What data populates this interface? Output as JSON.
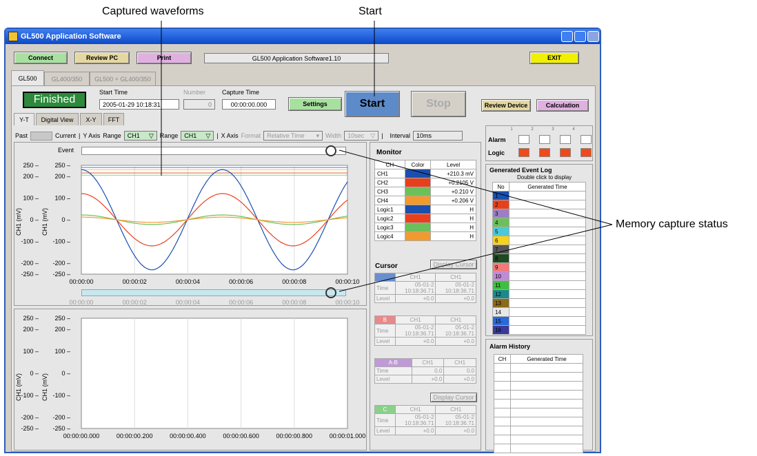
{
  "callouts": {
    "captured_waveforms": "Captured waveforms",
    "start": "Start",
    "memory_capture_status": "Memory capture status"
  },
  "window": {
    "title": "GL500 Application Software"
  },
  "toolbar": {
    "connect": "Connect",
    "review_pc": "Review PC",
    "print": "Print",
    "version": "GL500 Application Software1.10",
    "exit": "EXIT"
  },
  "device_tabs": [
    "GL500",
    "GL400/350",
    "GL500 + GL400/350"
  ],
  "status": {
    "state": "Finished",
    "start_time_label": "Start Time",
    "start_time": "2005-01-29 10:18:31",
    "number_label": "Number",
    "number": "0",
    "capture_time_label": "Capture Time",
    "capture_time": "00:00:00.000",
    "settings": "Settings",
    "start": "Start",
    "stop": "Stop",
    "review_device": "Review Device",
    "calculation": "Calculation"
  },
  "view_tabs": [
    "Y-T",
    "Digital View",
    "X-Y",
    "FFT"
  ],
  "axis_bar": {
    "past": "Past",
    "current": "Current",
    "y_axis": "Y Axis",
    "range_label": "Range",
    "ch": "CH1",
    "x_axis": "X Axis",
    "format_label": "Format",
    "format": "Relative Time",
    "width_label": "Width",
    "width": "10sec",
    "interval_label": "Interval",
    "interval": "10ms"
  },
  "upper_plot": {
    "event_label": "Event",
    "ylabel": "CH1 (mV)",
    "y_ticks": [
      "250",
      "200",
      "100",
      "0",
      "-100",
      "-200",
      "-250"
    ],
    "x_ticks": [
      "00:00:00",
      "00:00:02",
      "00:00:04",
      "00:00:06",
      "00:00:08",
      "00:00:10"
    ]
  },
  "lower_plot": {
    "ylabel": "CH1 (mV)",
    "y_ticks": [
      "250",
      "200",
      "100",
      "0",
      "-100",
      "-200",
      "-250"
    ],
    "x_ticks": [
      "00:00:00.000",
      "00:00:00.200",
      "00:00:00.400",
      "00:00:00.600",
      "00:00:00.800",
      "00:00:01.000"
    ]
  },
  "monitor": {
    "title": "Monitor",
    "headers": [
      "CH",
      "Color",
      "Level"
    ],
    "rows": [
      {
        "ch": "CH1",
        "color": "#1a4fb0",
        "level": "+210.3 mV"
      },
      {
        "ch": "CH2",
        "color": "#e8401c",
        "level": "+0.2105 V"
      },
      {
        "ch": "CH3",
        "color": "#6cc05c",
        "level": "+0.210 V"
      },
      {
        "ch": "CH4",
        "color": "#f29a2e",
        "level": "+0.206 V"
      },
      {
        "ch": "Logic1",
        "color": "#1a4fb0",
        "level": "H"
      },
      {
        "ch": "Logic2",
        "color": "#e8401c",
        "level": "H"
      },
      {
        "ch": "Logic3",
        "color": "#6cc05c",
        "level": "H"
      },
      {
        "ch": "Logic4",
        "color": "#f29a2e",
        "level": "H"
      }
    ]
  },
  "cursor": {
    "title": "Cursor",
    "display_cursor": "Display Cursor",
    "time": "Time",
    "level": "Level",
    "ch": "CH1",
    "date": "05-01-2",
    "clock": "10:18:36.71",
    "lvl": "+0.0",
    "zero": "0.0",
    "b_label": "B",
    "ab_label": "A-B",
    "c_label": "C"
  },
  "alarm_logic": {
    "nums": [
      "1",
      "2",
      "3",
      "4"
    ],
    "alarm": "Alarm",
    "logic": "Logic"
  },
  "event_log": {
    "title": "Generated Event Log",
    "hint": "Double click to display",
    "headers": [
      "No",
      "Generated Time"
    ],
    "rows": [
      {
        "no": "1",
        "color": "#1a4fb0"
      },
      {
        "no": "2",
        "color": "#e8401c"
      },
      {
        "no": "3",
        "color": "#9b7fc4"
      },
      {
        "no": "4",
        "color": "#6cc05c"
      },
      {
        "no": "5",
        "color": "#4ec8d8"
      },
      {
        "no": "6",
        "color": "#f6d21c"
      },
      {
        "no": "7",
        "color": "#555555"
      },
      {
        "no": "8",
        "color": "#1f4a1f"
      },
      {
        "no": "9",
        "color": "#f07a7a"
      },
      {
        "no": "10",
        "color": "#c08ad8"
      },
      {
        "no": "11",
        "color": "#3fbf3f"
      },
      {
        "no": "12",
        "color": "#1c8a8a"
      },
      {
        "no": "13",
        "color": "#8a6a1c"
      },
      {
        "no": "14",
        "color": "#e8e8e8"
      },
      {
        "no": "15",
        "color": "#2a6ad8"
      },
      {
        "no": "16",
        "color": "#3a3a9a"
      }
    ]
  },
  "alarm_history": {
    "title": "Alarm History",
    "headers": [
      "CH",
      "Generated Time"
    ]
  }
}
